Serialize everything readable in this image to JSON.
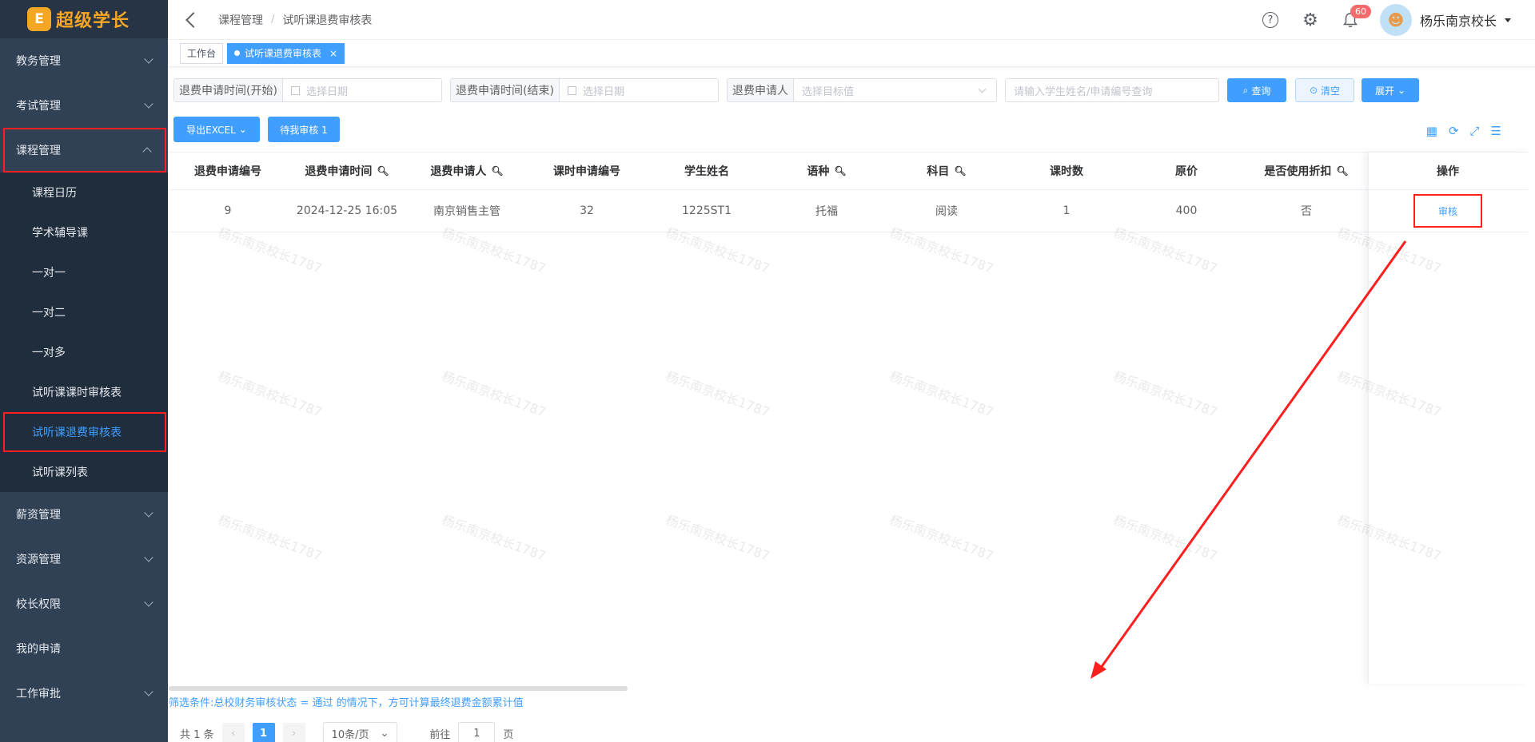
{
  "app": {
    "logo_mark": "E",
    "logo_text": "超级学长"
  },
  "sidebar": {
    "items": [
      {
        "label": "教务管理"
      },
      {
        "label": "考试管理"
      },
      {
        "label": "课程管理"
      },
      {
        "label": "薪资管理"
      },
      {
        "label": "资源管理"
      },
      {
        "label": "校长权限"
      },
      {
        "label": "我的申请"
      },
      {
        "label": "工作审批"
      }
    ],
    "sub_items": [
      {
        "label": "课程日历"
      },
      {
        "label": "学术辅导课"
      },
      {
        "label": "一对一"
      },
      {
        "label": "一对二"
      },
      {
        "label": "一对多"
      },
      {
        "label": "试听课课时审核表"
      },
      {
        "label": "试听课退费审核表"
      },
      {
        "label": "试听课列表"
      }
    ]
  },
  "header": {
    "breadcrumb": [
      "课程管理",
      "试听课退费审核表"
    ],
    "breadcrumb_sep": "/",
    "help_icon": "?",
    "notification_count": "60",
    "user_name": "杨乐南京校长"
  },
  "tags": {
    "home": "工作台",
    "active": "试听课退费审核表",
    "close": "×"
  },
  "filters": {
    "start_label": "退费申请时间(开始)",
    "start_placeholder": "选择日期",
    "end_label": "退费申请时间(结束)",
    "end_placeholder": "选择日期",
    "applicant_label": "退费申请人",
    "applicant_placeholder": "选择目标值",
    "keyword_placeholder": "请输入学生姓名/申请编号查询",
    "search_btn": "查询",
    "clear_btn": "清空",
    "expand_btn": "展开"
  },
  "actions": {
    "export_btn": "导出EXCEL",
    "pending_btn": "待我审核 1"
  },
  "table": {
    "columns": [
      "退费申请编号",
      "退费申请时间",
      "退费申请人",
      "课时申请编号",
      "学生姓名",
      "语种",
      "科目",
      "课时数",
      "原价",
      "是否使用折扣"
    ],
    "op_header": "操作",
    "rows": [
      {
        "cells": [
          "9",
          "2024-12-25 16:05",
          "南京销售主管",
          "32",
          "1225ST1",
          "托福",
          "阅读",
          "1",
          "400",
          "否"
        ],
        "op": "审核"
      }
    ]
  },
  "note": "筛选条件:总校财务审核状态 = 通过 的情况下，方可计算最终退费金额累计值",
  "pager": {
    "total": "共 1 条",
    "current": "1",
    "page_size": "10条/页",
    "goto_prefix": "前往",
    "goto_value": "1",
    "goto_suffix": "页"
  },
  "watermark": "杨乐南京校长1787",
  "colors": {
    "accent": "#409eff",
    "sidebar": "#304156",
    "highlight": "#ff1f1f"
  }
}
